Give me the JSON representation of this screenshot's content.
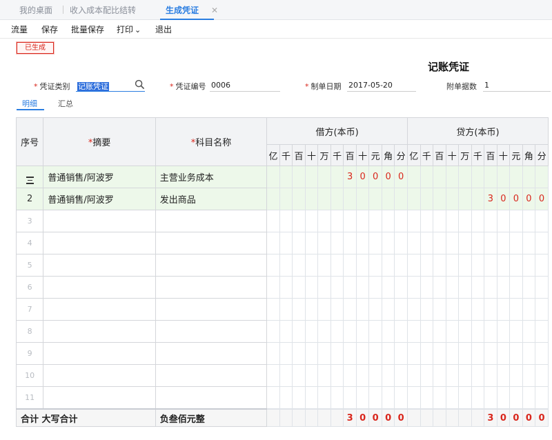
{
  "tabs": [
    {
      "label": "我的桌面"
    },
    {
      "label": "收入成本配比结转"
    },
    {
      "label": "生成凭证",
      "close": "✕"
    }
  ],
  "toolbar": {
    "items": [
      {
        "label": "流量"
      },
      {
        "label": "保存"
      },
      {
        "label": "批量保存"
      },
      {
        "label": "打印",
        "caret": "⌄"
      },
      {
        "label": "退出"
      }
    ]
  },
  "status_badge": "已生成",
  "voucher_title": "记账凭证",
  "fields": {
    "category_label": "凭证类别",
    "category_value": "记账凭证",
    "number_label": "凭证编号",
    "number_value": "0006",
    "date_label": "制单日期",
    "date_value": "2017-05-20",
    "attach_label": "附单据数",
    "attach_value": "1",
    "required_mark": "*"
  },
  "subtabs": {
    "detail": "明细",
    "summary": "汇总"
  },
  "table": {
    "header": {
      "seq": "序号",
      "summary": "摘要",
      "account": "科目名称",
      "debit": "借方(本币)",
      "credit": "贷方(本币)",
      "units": [
        "亿",
        "千",
        "百",
        "十",
        "万",
        "千",
        "百",
        "十",
        "元",
        "角",
        "分"
      ]
    },
    "rows": [
      {
        "idx": "",
        "summary": "普通销售/阿波罗",
        "account": "主营业务成本",
        "debit": [
          "",
          "",
          "",
          "",
          "",
          "",
          "3",
          "0",
          "0",
          "0",
          "0"
        ],
        "credit": [
          "",
          "",
          "",
          "",
          "",
          "",
          "",
          "",
          "",
          "",
          ""
        ]
      },
      {
        "idx": "2",
        "summary": "普通销售/阿波罗",
        "account": "发出商品",
        "debit": [
          "",
          "",
          "",
          "",
          "",
          "",
          "",
          "",
          "",
          "",
          ""
        ],
        "credit": [
          "",
          "",
          "",
          "",
          "",
          "",
          "3",
          "0",
          "0",
          "0",
          "0"
        ]
      }
    ],
    "empty_rows": [
      "3",
      "4",
      "5",
      "6",
      "7",
      "8",
      "9",
      "10",
      "11"
    ],
    "footer": {
      "label": "合计 大写合计",
      "amount_words": "负叁佰元整",
      "debit": [
        "",
        "",
        "",
        "",
        "",
        "",
        "3",
        "0",
        "0",
        "0",
        "0"
      ],
      "credit": [
        "",
        "",
        "",
        "",
        "",
        "",
        "3",
        "0",
        "0",
        "0",
        "0"
      ]
    }
  },
  "colors": {
    "accent": "#2a7de1",
    "red": "#d9261c",
    "row_fill": "#edf8ea"
  }
}
